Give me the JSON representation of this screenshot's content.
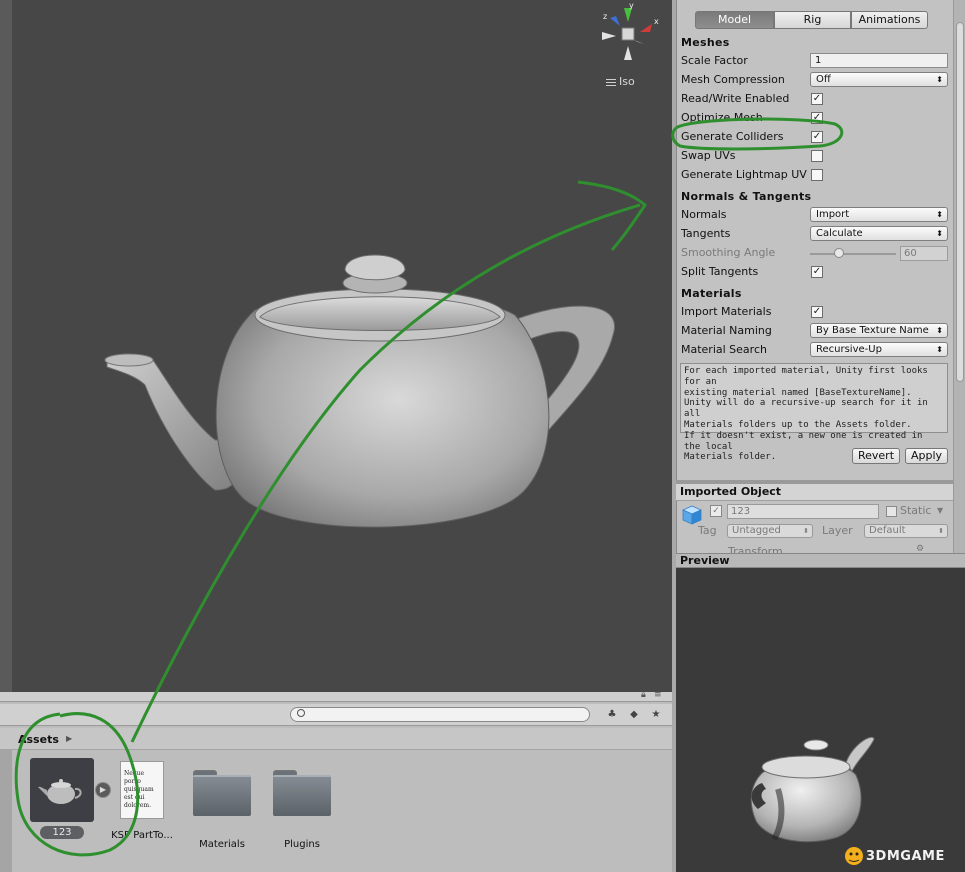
{
  "scene": {
    "projection_label": "Iso",
    "gizmo_axes": {
      "y": "y",
      "z": "z",
      "x": "x"
    }
  },
  "project": {
    "breadcrumb": "Assets",
    "assets": [
      {
        "name": "123",
        "kind": "model",
        "selected": true
      },
      {
        "name": "KSP PartTo...",
        "kind": "document",
        "thumb_text": "Neque porro quisquam est qui dolorem."
      },
      {
        "name": "Materials",
        "kind": "folder"
      },
      {
        "name": "Plugins",
        "kind": "folder"
      }
    ]
  },
  "inspector": {
    "tabs": [
      "Model",
      "Rig",
      "Animations"
    ],
    "active_tab": "Model",
    "meshes": {
      "title": "Meshes",
      "scale_factor": {
        "label": "Scale Factor",
        "value": "1"
      },
      "mesh_compression": {
        "label": "Mesh Compression",
        "value": "Off"
      },
      "read_write": {
        "label": "Read/Write Enabled",
        "checked": true
      },
      "optimize_mesh": {
        "label": "Optimize Mesh",
        "checked": true
      },
      "generate_colliders": {
        "label": "Generate Colliders",
        "checked": true
      },
      "swap_uvs": {
        "label": "Swap UVs",
        "checked": false
      },
      "lightmap_uvs": {
        "label": "Generate Lightmap UV",
        "checked": false
      }
    },
    "normals": {
      "title": "Normals & Tangents",
      "normals": {
        "label": "Normals",
        "value": "Import"
      },
      "tangents": {
        "label": "Tangents",
        "value": "Calculate"
      },
      "smoothing_angle": {
        "label": "Smoothing Angle",
        "value": "60",
        "fraction": 0.33
      },
      "split_tangents": {
        "label": "Split Tangents",
        "checked": true
      }
    },
    "materials": {
      "title": "Materials",
      "import_materials": {
        "label": "Import Materials",
        "checked": true
      },
      "material_naming": {
        "label": "Material Naming",
        "value": "By Base Texture Name"
      },
      "material_search": {
        "label": "Material Search",
        "value": "Recursive-Up"
      },
      "help_lines": [
        "For each imported material, Unity first looks for an",
        "existing material named [BaseTextureName].",
        "Unity will do a recursive-up search for it in all",
        "Materials folders up to the Assets folder.",
        "If it doesn't exist, a new one is created in the local",
        "Materials folder."
      ]
    },
    "buttons": {
      "revert": "Revert",
      "apply": "Apply"
    },
    "imported_object": {
      "title": "Imported Object",
      "name": "123",
      "static_label": "Static",
      "tag_label": "Tag",
      "tag_value": "Untagged",
      "layer_label": "Layer",
      "layer_value": "Default",
      "transform_label": "Transform"
    }
  },
  "preview": {
    "title": "Preview"
  },
  "watermark": {
    "text": "3DMGAME"
  },
  "colors": {
    "scene_bg": "#474747",
    "annotation_green": "#2f8f2f",
    "preview_bg": "#3a3a3a"
  }
}
